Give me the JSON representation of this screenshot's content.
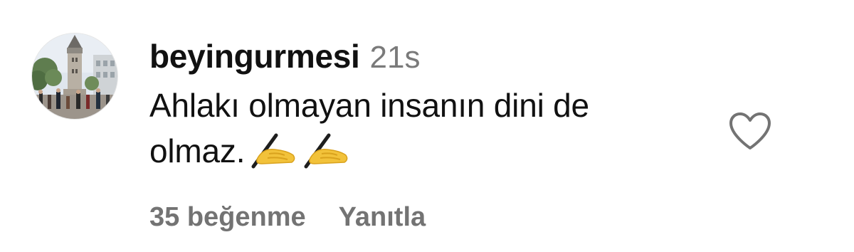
{
  "comment": {
    "username": "beyingurmesi",
    "time_ago": "21s",
    "text": "Ahlakı olmayan insanın dini de olmaz.",
    "emojis": [
      "writing-hand-emoji",
      "writing-hand-emoji"
    ],
    "likes_label": "35 beğenme",
    "reply_label": "Yanıtla",
    "like_icon": "heart-outline-icon",
    "avatar_icon": "galata-tower-photo"
  },
  "colors": {
    "text": "#111111",
    "muted": "#737373",
    "time": "#7a7a7a",
    "background": "#ffffff",
    "emoji": "#f2c23a"
  }
}
